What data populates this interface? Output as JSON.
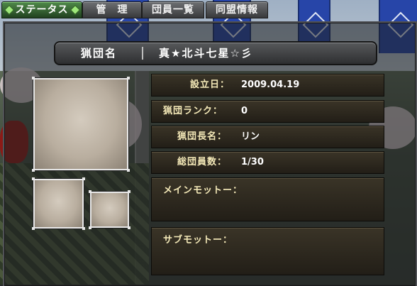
{
  "tabs": [
    {
      "label": "ステータス",
      "active": true
    },
    {
      "label": "管　理",
      "active": false
    },
    {
      "label": "団員一覧",
      "active": false
    },
    {
      "label": "同盟情報",
      "active": false
    }
  ],
  "guild": {
    "name_label": "猟団名",
    "name": "真★北斗七星☆彡"
  },
  "info": {
    "founded_label": "設立日：",
    "founded": "2009.04.19",
    "rank_label": "猟団ランク：",
    "rank": "0",
    "leader_label": "猟団長名：",
    "leader": "リン",
    "members_label": "総団員数：",
    "members": "1/30",
    "main_motto_label": "メインモットー：",
    "sub_motto_label": "サブモットー："
  },
  "colors": {
    "active_tab": "#3f7a3a",
    "label_text": "#f4e9b8",
    "banner": "#2745a8"
  }
}
